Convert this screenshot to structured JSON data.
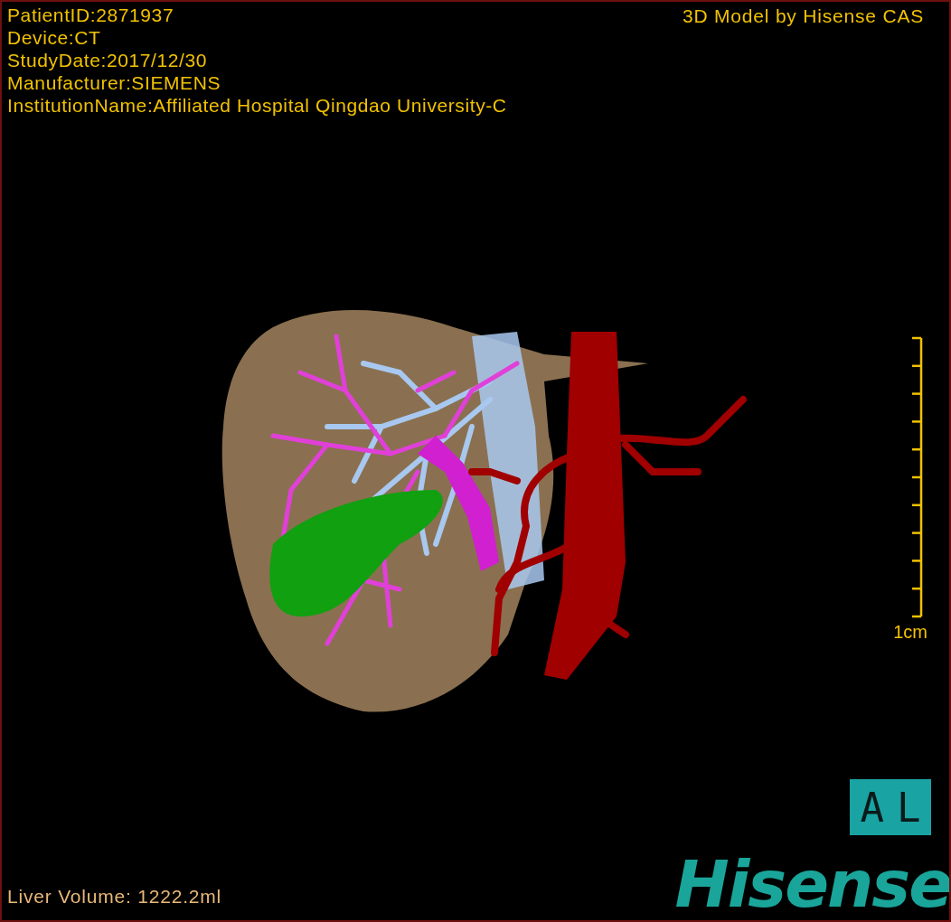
{
  "info_lines": [
    "PatientID:2871937",
    "Device:CT",
    "StudyDate:2017/12/30",
    "Manufacturer:SIEMENS",
    "InstitutionName:Affiliated Hospital Qingdao University-C"
  ],
  "title": "3D Model by Hisense CAS",
  "scale_bar": {
    "label": "1cm"
  },
  "orientation_badge": "AL",
  "footer": "Liver Volume: 1222.2ml",
  "logo": "Hisense"
}
